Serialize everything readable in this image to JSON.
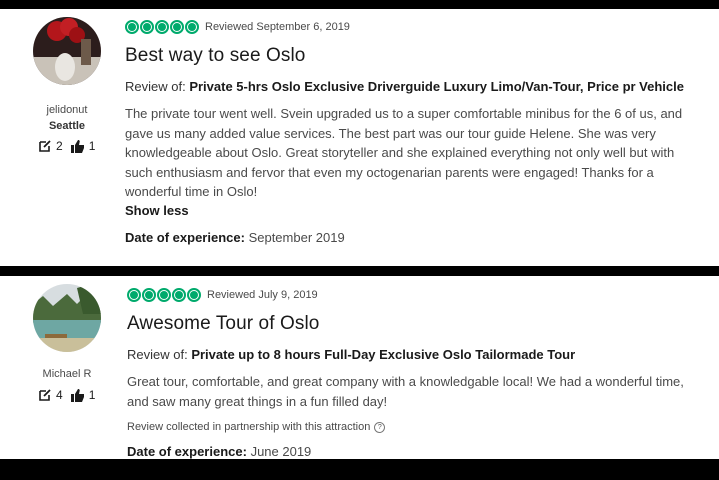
{
  "reviews": [
    {
      "username": "jelidonut",
      "location": "Seattle",
      "contributions": "2",
      "helpful_votes": "1",
      "rating": 5,
      "reviewed_date": "Reviewed September 6, 2019",
      "title": "Best way to see Oslo",
      "review_of_label": "Review of:",
      "review_of_title": "Private 5-hrs Oslo Exclusive Driverguide Luxury Limo/Van-Tour, Price pr Vehicle",
      "body": "The private tour went well. Svein upgraded us to a super comfortable minibus for the 6 of us, and gave us many added value services. The best part was our tour guide Helene. She was very knowledgeable about Oslo. Great storyteller and she explained everything not only well but with such enthusiasm and fervor that even my octogenarian parents were engaged! Thanks for a wonderful time in Oslo!",
      "show_less": "Show less",
      "date_label": "Date of experience:",
      "date_value": "September 2019"
    },
    {
      "username": "Michael R",
      "location": "",
      "contributions": "4",
      "helpful_votes": "1",
      "rating": 5,
      "reviewed_date": "Reviewed July 9, 2019",
      "title": "Awesome Tour of Oslo",
      "review_of_label": "Review of:",
      "review_of_title": "Private up to 8 hours Full-Day Exclusive Oslo Tailormade Tour",
      "body": "Great tour, comfortable, and great company with a knowledgable local! We had a wonderful time, and saw many great things in a fun filled day!",
      "partner_note": "Review collected in partnership with this attraction",
      "date_label": "Date of experience:",
      "date_value": "June 2019"
    }
  ],
  "icons": {
    "contributions": "pencil-square-icon",
    "helpful": "thumbs-up-icon",
    "info": "info-circle-icon",
    "bubble": "rating-bubble-icon"
  },
  "colors": {
    "rating_green": "#00aa6c",
    "background": "#000000"
  }
}
